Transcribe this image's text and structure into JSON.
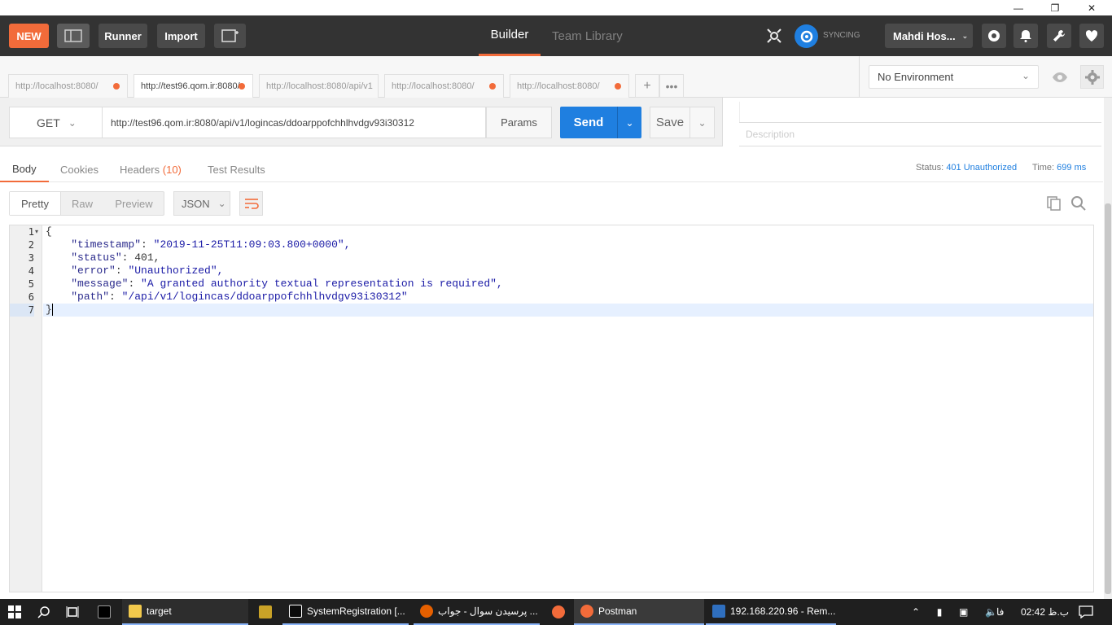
{
  "header": {
    "new_label": "NEW",
    "runner_label": "Runner",
    "import_label": "Import",
    "tabs": [
      {
        "label": "Builder"
      },
      {
        "label": "Team Library"
      }
    ],
    "sync_label": "SYNCING",
    "user_name": "Mahdi Hos..."
  },
  "request_tabs": [
    {
      "label": "http://localhost:8080/",
      "active": false
    },
    {
      "label": "http://test96.qom.ir:8080/",
      "active": true
    },
    {
      "label": "http://localhost:8080/api/v1",
      "active": false
    },
    {
      "label": "http://localhost:8080/",
      "active": false
    },
    {
      "label": "http://localhost:8080/",
      "active": false
    }
  ],
  "environment": {
    "selected": "No Environment"
  },
  "request": {
    "method": "GET",
    "url": "http://test96.qom.ir:8080/api/v1/logincas/ddoarppofchhlhvdgv93i30312",
    "params_label": "Params",
    "send_label": "Send",
    "save_label": "Save",
    "description_placeholder": "Description"
  },
  "response": {
    "tabs": {
      "body": "Body",
      "cookies": "Cookies",
      "headers": "Headers",
      "headers_count": "(10)",
      "tests": "Test Results"
    },
    "status_label": "Status:",
    "status_value": "401 Unauthorized",
    "time_label": "Time:",
    "time_value": "699 ms",
    "format_tabs": [
      "Pretty",
      "Raw",
      "Preview"
    ],
    "format_select": "JSON",
    "lines": [
      {
        "num": "1",
        "key": "",
        "value": "",
        "text": "{"
      },
      {
        "num": "2",
        "key": "\"timestamp\"",
        "value": "\"2019-11-25T11:09:03.800+0000\","
      },
      {
        "num": "3",
        "key": "\"status\"",
        "value": "401,"
      },
      {
        "num": "4",
        "key": "\"error\"",
        "value": "\"Unauthorized\","
      },
      {
        "num": "5",
        "key": "\"message\"",
        "value": "\"A granted authority textual representation is required\","
      },
      {
        "num": "6",
        "key": "\"path\"",
        "value": "\"/api/v1/logincas/ddoarppofchhlhvdgv93i30312\""
      },
      {
        "num": "7",
        "key": "",
        "value": "",
        "text": "}"
      }
    ]
  },
  "taskbar": {
    "items": [
      {
        "label": "target"
      },
      {
        "label": "SystemRegistration [..."
      },
      {
        "label": "پرسیدن سوال - جواب ..."
      },
      {
        "label": "Postman"
      },
      {
        "label": "192.168.220.96 - Rem..."
      }
    ],
    "lang": "فا",
    "clock": "ب.ظ 02:42"
  },
  "colors": {
    "accent": "#f26b3a",
    "send": "#1f7fe0",
    "header": "#333333"
  }
}
